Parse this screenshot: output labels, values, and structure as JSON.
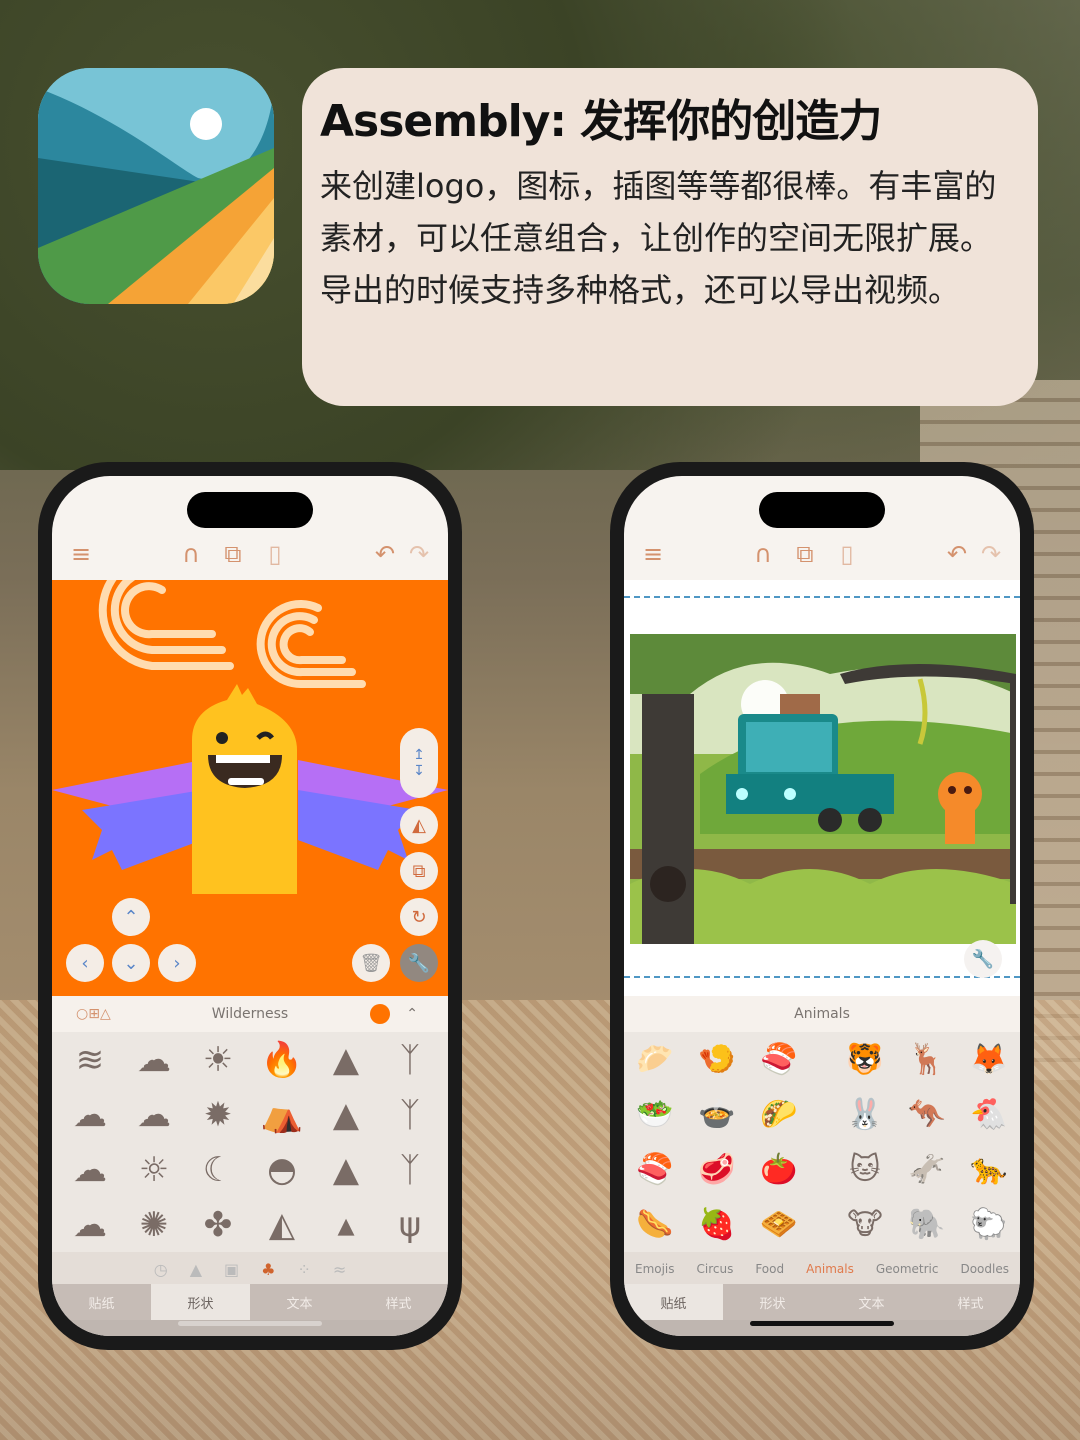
{
  "header": {
    "title": "Assembly: 发挥你的创造力",
    "description": "来创建logo，图标，插图等等都很棒。有丰富的素材，可以任意组合，让创作的空间无限扩展。导出的时候支持多种格式，还可以导出视频。"
  },
  "colors": {
    "accent": "#d4926e",
    "canvas_orange": "#ff7300",
    "active_category": "#e07a4c",
    "dash_line": "#4f97c4"
  },
  "phone_left": {
    "toolbar": {
      "menu_icon": "hamburger-icon",
      "magnet_icon": "magnet-icon",
      "copy_icon": "copy-icon",
      "paste_icon": "paste-icon",
      "undo_icon": "undo-icon",
      "redo_icon": "redo-icon"
    },
    "category": {
      "shape_icons": "○⊞△",
      "title": "Wilderness",
      "color_swatch": "#ff7300"
    },
    "shapes": [
      [
        "wind",
        "cloud",
        "sun",
        "campfire",
        "pine-tree",
        "bare-tree"
      ],
      [
        "cloud",
        "cloud",
        "sun-burst",
        "tent",
        "pine-tree",
        "bare-tree"
      ],
      [
        "cloud",
        "sun-rays",
        "moon",
        "rock",
        "pine-tree",
        "bare-tree"
      ],
      [
        "cloud",
        "sun-ring",
        "maple-leaf",
        "hill",
        "spire-tree",
        "cactus"
      ]
    ],
    "sub_icons": [
      "clock",
      "triangle",
      "square",
      "tree",
      "dots",
      "wifi"
    ],
    "tabs": [
      {
        "label": "贴纸",
        "active": false
      },
      {
        "label": "形状",
        "active": true
      },
      {
        "label": "文本",
        "active": false
      },
      {
        "label": "样式",
        "active": false
      }
    ]
  },
  "phone_right": {
    "category": {
      "title": "Animals"
    },
    "stickers": [
      [
        "🥟",
        "🍤",
        "🍣",
        "🐯",
        "🦌",
        "🦊"
      ],
      [
        "🥗",
        "🍲",
        "🌮",
        "🐰",
        "🦘",
        "🐔"
      ],
      [
        "🍣",
        "🥩",
        "🍅",
        "🐱",
        "🫏",
        "🐆"
      ],
      [
        "🌭",
        "🍓",
        "🧇",
        "🐮",
        "🐘",
        "🐑"
      ]
    ],
    "sub_categories": [
      {
        "label": "Emojis",
        "active": false
      },
      {
        "label": "Circus",
        "active": false
      },
      {
        "label": "Food",
        "active": false
      },
      {
        "label": "Animals",
        "active": true
      },
      {
        "label": "Geometric",
        "active": false
      },
      {
        "label": "Doodles",
        "active": false
      }
    ],
    "tabs": [
      {
        "label": "贴纸",
        "active": true
      },
      {
        "label": "形状",
        "active": false
      },
      {
        "label": "文本",
        "active": false
      },
      {
        "label": "样式",
        "active": false
      }
    ]
  }
}
